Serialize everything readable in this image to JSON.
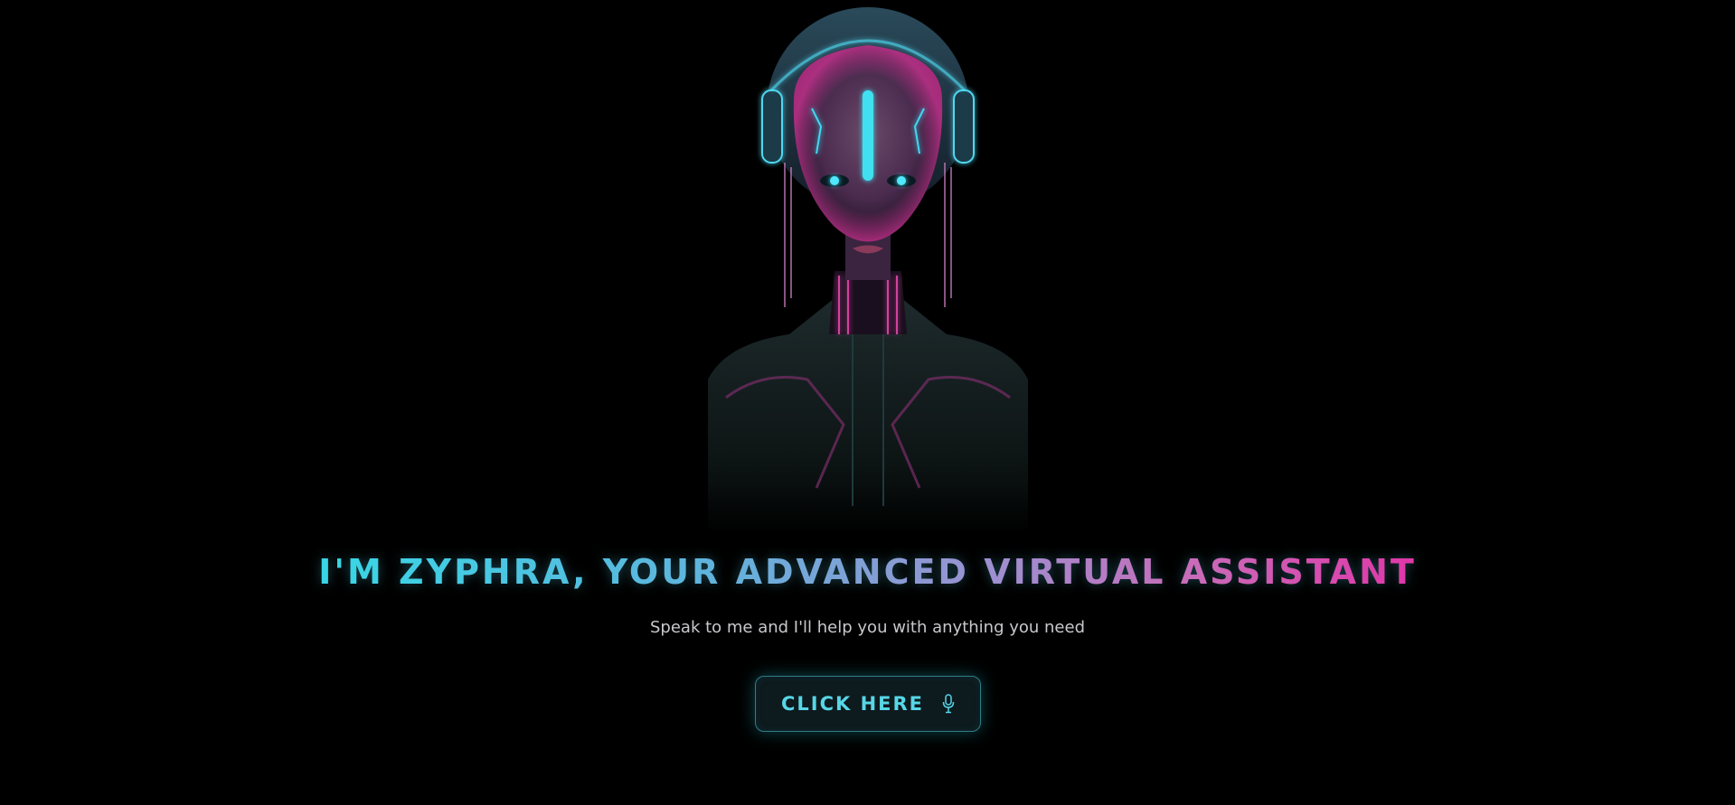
{
  "hero": {
    "image_name": "zyphra-portrait"
  },
  "headline": {
    "text": "I'M ZYPHRA, YOUR ADVANCED VIRTUAL ASSISTANT"
  },
  "subtitle": {
    "text": "Speak to me and I'll help you with anything you need"
  },
  "cta": {
    "label": "CLICK HERE",
    "icon": "microphone-icon"
  },
  "colors": {
    "background": "#000000",
    "accent_cyan": "#37d7e6",
    "accent_magenta": "#e036a8",
    "subtitle_text": "#c8c8cc",
    "button_border": "#2f7d86"
  }
}
